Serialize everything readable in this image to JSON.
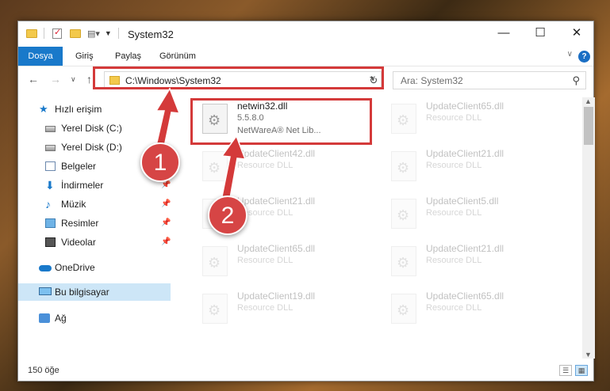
{
  "window": {
    "title": "System32",
    "controls": {
      "minimize": "—",
      "maximize": "☐",
      "close": "✕"
    }
  },
  "ribbon": {
    "tabs": [
      {
        "label": "Dosya",
        "active": true
      },
      {
        "label": "Giriş"
      },
      {
        "label": "Paylaş"
      },
      {
        "label": "Görünüm"
      }
    ],
    "help_label": "?"
  },
  "address": {
    "path": "C:\\Windows\\System32",
    "search_placeholder": "Ara: System32"
  },
  "sidebar": {
    "items": [
      {
        "label": "Hızlı erişim",
        "icon": "star-icon"
      },
      {
        "label": "Yerel Disk (C:)",
        "icon": "disk-icon"
      },
      {
        "label": "Yerel Disk (D:)",
        "icon": "disk-icon"
      },
      {
        "label": "Belgeler",
        "icon": "documents-icon"
      },
      {
        "label": "İndirmeler",
        "icon": "download-icon",
        "pinned": true
      },
      {
        "label": "Müzik",
        "icon": "music-icon",
        "pinned": true
      },
      {
        "label": "Resimler",
        "icon": "pictures-icon",
        "pinned": true
      },
      {
        "label": "Videolar",
        "icon": "videos-icon",
        "pinned": true
      },
      {
        "label": "OneDrive",
        "icon": "cloud-icon"
      },
      {
        "label": "Bu bilgisayar",
        "icon": "computer-icon",
        "selected": true
      },
      {
        "label": "Ağ",
        "icon": "network-icon"
      }
    ]
  },
  "files": {
    "highlighted": {
      "name": "netwin32.dll",
      "version": "5.5.8.0",
      "description": "NetWareA® Net Lib..."
    },
    "left_column": [
      {
        "name": "UpdateClient42.dll",
        "type": "Resource DLL"
      },
      {
        "name": "UpdateClient21.dll",
        "type": "Resource DLL"
      },
      {
        "name": "UpdateClient65.dll",
        "type": "Resource DLL"
      },
      {
        "name": "UpdateClient19.dll",
        "type": "Resource DLL"
      }
    ],
    "right_column": [
      {
        "name": "UpdateClient65.dll",
        "type": "Resource DLL"
      },
      {
        "name": "UpdateClient21.dll",
        "type": "Resource DLL"
      },
      {
        "name": "UpdateClient5.dll",
        "type": "Resource DLL"
      },
      {
        "name": "UpdateClient21.dll",
        "type": "Resource DLL"
      },
      {
        "name": "UpdateClient65.dll",
        "type": "Resource DLL"
      }
    ]
  },
  "status": {
    "count": "150 öğe"
  },
  "annotations": {
    "marker1": "1",
    "marker2": "2",
    "color": "#d43a3a"
  }
}
